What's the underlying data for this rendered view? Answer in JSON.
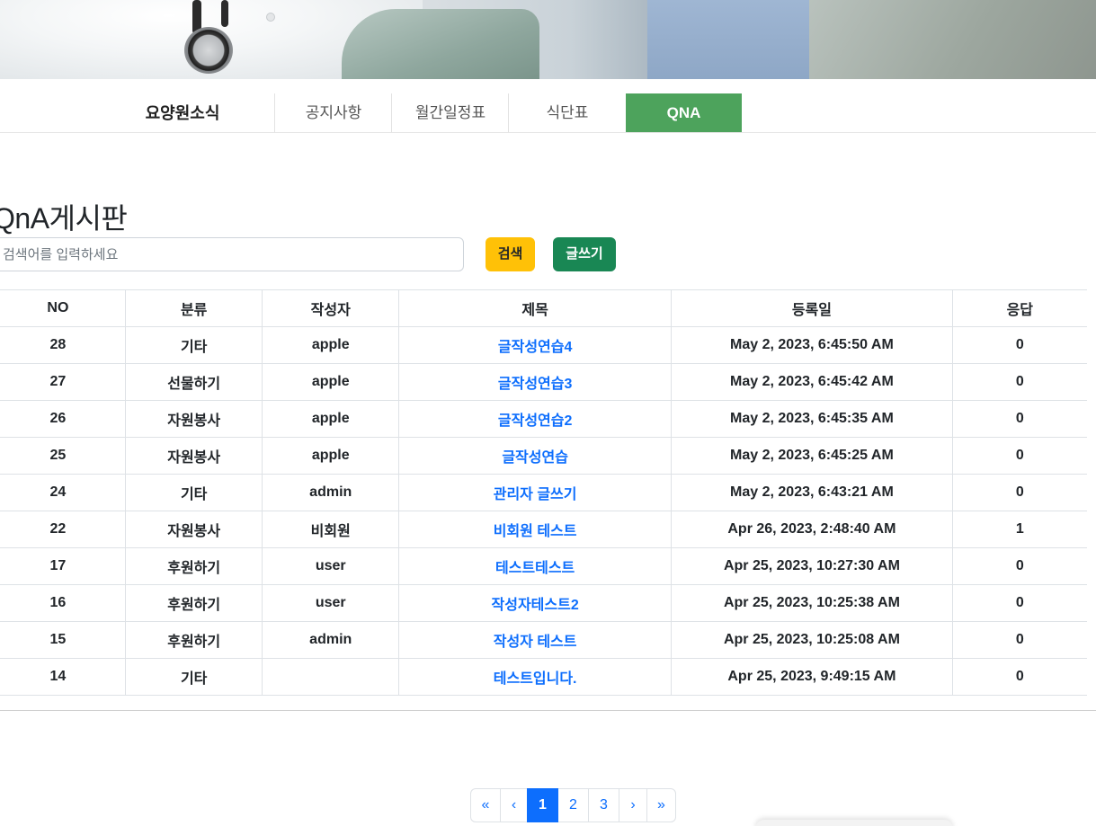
{
  "nav": {
    "section_title": "요양원소식",
    "tabs": [
      {
        "label": "공지사항",
        "active": false
      },
      {
        "label": "월간일정표",
        "active": false
      },
      {
        "label": "식단표",
        "active": false
      },
      {
        "label": "QNA",
        "active": true
      }
    ],
    "active_color": "#4da35c"
  },
  "page": {
    "title": "QnA게시판"
  },
  "search": {
    "placeholder": "검색어를 입력하세요",
    "value": "",
    "search_label": "검색",
    "write_label": "글쓰기"
  },
  "table": {
    "headers": [
      "NO",
      "분류",
      "작성자",
      "제목",
      "등록일",
      "응답"
    ],
    "rows": [
      {
        "no": "28",
        "category": "기타",
        "author": "apple",
        "title": "글작성연습4",
        "date": "May 2, 2023, 6:45:50 AM",
        "answers": "0"
      },
      {
        "no": "27",
        "category": "선물하기",
        "author": "apple",
        "title": "글작성연습3",
        "date": "May 2, 2023, 6:45:42 AM",
        "answers": "0"
      },
      {
        "no": "26",
        "category": "자원봉사",
        "author": "apple",
        "title": "글작성연습2",
        "date": "May 2, 2023, 6:45:35 AM",
        "answers": "0"
      },
      {
        "no": "25",
        "category": "자원봉사",
        "author": "apple",
        "title": "글작성연습",
        "date": "May 2, 2023, 6:45:25 AM",
        "answers": "0"
      },
      {
        "no": "24",
        "category": "기타",
        "author": "admin",
        "title": "관리자 글쓰기",
        "date": "May 2, 2023, 6:43:21 AM",
        "answers": "0"
      },
      {
        "no": "22",
        "category": "자원봉사",
        "author": "비회원",
        "title": "비회원 테스트",
        "date": "Apr 26, 2023, 2:48:40 AM",
        "answers": "1"
      },
      {
        "no": "17",
        "category": "후원하기",
        "author": "user",
        "title": "테스트테스트",
        "date": "Apr 25, 2023, 10:27:30 AM",
        "answers": "0"
      },
      {
        "no": "16",
        "category": "후원하기",
        "author": "user",
        "title": "작성자테스트2",
        "date": "Apr 25, 2023, 10:25:38 AM",
        "answers": "0"
      },
      {
        "no": "15",
        "category": "후원하기",
        "author": "admin",
        "title": "작성자 테스트",
        "date": "Apr 25, 2023, 10:25:08 AM",
        "answers": "0"
      },
      {
        "no": "14",
        "category": "기타",
        "author": "",
        "title": "테스트입니다.",
        "date": "Apr 25, 2023, 9:49:15 AM",
        "answers": "0"
      }
    ]
  },
  "pagination": {
    "first": "«",
    "prev": "‹",
    "pages": [
      "1",
      "2",
      "3"
    ],
    "current": "1",
    "next": "›",
    "last": "»"
  }
}
